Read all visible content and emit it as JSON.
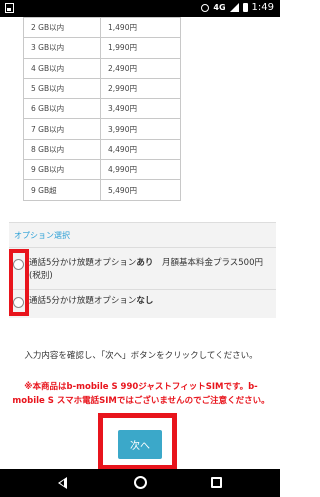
{
  "status_bar": {
    "network": "4G",
    "time": "1:49"
  },
  "price_table": {
    "rows": [
      {
        "plan": "2 GB以内",
        "price": "1,490円"
      },
      {
        "plan": "3 GB以内",
        "price": "1,990円"
      },
      {
        "plan": "4 GB以内",
        "price": "2,490円"
      },
      {
        "plan": "5 GB以内",
        "price": "2,990円"
      },
      {
        "plan": "6 GB以内",
        "price": "3,490円"
      },
      {
        "plan": "7 GB以内",
        "price": "3,990円"
      },
      {
        "plan": "8 GB以内",
        "price": "4,490円"
      },
      {
        "plan": "9 GB以内",
        "price": "4,990円"
      },
      {
        "plan": "9 GB超",
        "price": "5,490円"
      }
    ]
  },
  "options": {
    "title": "オプション選択",
    "option_with": {
      "prefix": "通話5分かけ放題オプション",
      "emphasis": "あり",
      "suffix": "　月額基本料金プラス500円(税別)"
    },
    "option_without": {
      "prefix": "通話5分かけ放題オプション",
      "emphasis": "なし"
    }
  },
  "instruction": "入力内容を確認し、「次へ」ボタンをクリックしてください。",
  "notice": "※本商品はb-mobile S 990ジャストフィットSIMです。b-mobile S スマホ電話SIMではございませんのでご注意ください。",
  "next_button": "次へ"
}
